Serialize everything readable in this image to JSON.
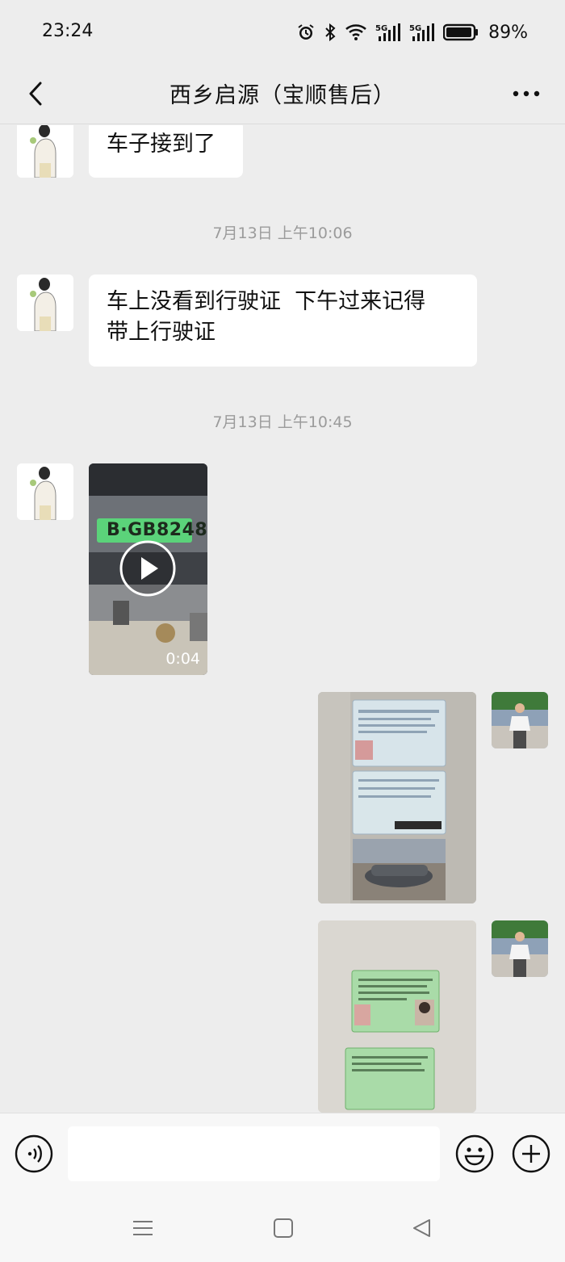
{
  "status_bar": {
    "time": "23:24",
    "battery": "89%",
    "icons": [
      "alarm-icon",
      "bluetooth-icon",
      "wifi-icon",
      "signal-5g-icon",
      "signal-5g-icon",
      "battery-icon"
    ]
  },
  "header": {
    "title": "西乡启源（宝顺售后）",
    "back_icon": "chevron-left-icon",
    "more_icon": "more-icon"
  },
  "messages": [
    {
      "side": "left",
      "type": "text",
      "text": "车子接到了"
    },
    {
      "type": "timestamp",
      "text": "7月13日 上午10:06"
    },
    {
      "side": "left",
      "type": "text",
      "line1": "车上没看到行驶证  下午过来记得",
      "line2": "带上行驶证"
    },
    {
      "type": "timestamp",
      "text": "7月13日 上午10:45"
    },
    {
      "side": "left",
      "type": "video",
      "duration": "0:04",
      "plate": "B·GB8248"
    },
    {
      "side": "right",
      "type": "image",
      "description_icon": "photo-icon"
    },
    {
      "side": "right",
      "type": "image",
      "description_icon": "photo-icon"
    }
  ],
  "input_bar": {
    "voice_icon": "voice-icon",
    "placeholder": "",
    "emoji_icon": "emoji-icon",
    "plus_icon": "plus-icon"
  },
  "system_nav": {
    "menu_icon": "menu-icon",
    "home_icon": "home-square-icon",
    "back_icon": "back-triangle-icon"
  },
  "colors": {
    "chat_bg": "#ededed",
    "bubble_bg": "#ffffff",
    "timestamp": "#9b9b9b",
    "plate_green": "#5bd37a"
  }
}
